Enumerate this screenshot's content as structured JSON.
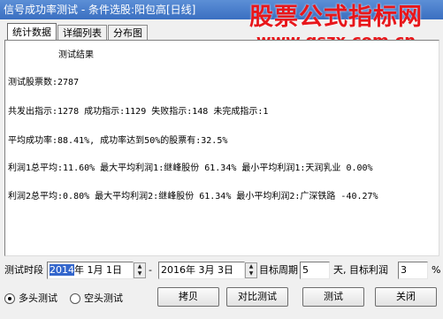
{
  "window": {
    "title": "信号成功率测试 - 条件选股:阳包高[日线]"
  },
  "watermark": {
    "brand": "股票公式指标网",
    "url": "www.gszx.com.cn"
  },
  "tabs": [
    {
      "label": "统计数据",
      "active": true
    },
    {
      "label": "详细列表",
      "active": false
    },
    {
      "label": "分布图",
      "active": false
    }
  ],
  "results": {
    "heading": "测试结果",
    "lines": [
      "测试股票数:2787",
      "共发出指示:1278 成功指示:1129 失败指示:148 未完成指示:1",
      "平均成功率:88.41%, 成功率达到50%的股票有:32.5%",
      "利润1总平均:11.60% 最大平均利润1:继峰股份 61.34% 最小平均利润1:天润乳业 0.00%",
      "利润2总平均:0.80% 最大平均利润2:继峰股份 61.34% 最小平均利润2:广深铁路 -40.27%"
    ]
  },
  "params": {
    "period_label": "测试时段",
    "start_year": "2014",
    "start_rest": "年  1月  1日",
    "dash": "-",
    "end_date": "2016年  3月  3日",
    "target_period_label": "目标周期",
    "target_period_value": "5",
    "target_profit_label": "天, 目标利润",
    "target_profit_value": "3",
    "percent": "%"
  },
  "mode": {
    "long_label": "多头测试",
    "long_selected": true,
    "short_label": "空头测试",
    "short_selected": false
  },
  "buttons": {
    "copy": "拷贝",
    "compare": "对比测试",
    "test": "测试",
    "close": "关闭"
  }
}
